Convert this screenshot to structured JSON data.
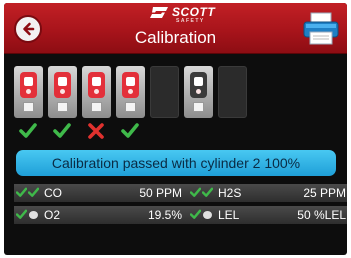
{
  "header": {
    "brand": "SCOTT",
    "brand_sub": "SAFETY",
    "title": "Calibration",
    "back_icon": "back-arrow-icon",
    "print_icon": "printer-icon"
  },
  "devices": [
    {
      "slot": 1,
      "state": "pass"
    },
    {
      "slot": 2,
      "state": "pass"
    },
    {
      "slot": 3,
      "state": "fail"
    },
    {
      "slot": 4,
      "state": "pass"
    },
    {
      "slot": 5,
      "state": "empty"
    },
    {
      "slot": 6,
      "state": "none"
    },
    {
      "slot": 7,
      "state": "empty"
    }
  ],
  "status_banner": "Calibration passed with cylinder 2 100%",
  "gases": [
    {
      "name": "CO",
      "value": "50 PPM",
      "icons": [
        "check",
        "check"
      ]
    },
    {
      "name": "H2S",
      "value": "25 PPM",
      "icons": [
        "check",
        "check"
      ]
    },
    {
      "name": "O2",
      "value": "19.5%",
      "icons": [
        "check",
        "pill"
      ]
    },
    {
      "name": "LEL",
      "value": "50 %LEL",
      "icons": [
        "check",
        "pill"
      ]
    }
  ],
  "colors": {
    "header_red": "#b21a20",
    "banner_blue": "#33b4e8",
    "pass_green": "#3fb94a",
    "fail_red": "#e0312e"
  }
}
